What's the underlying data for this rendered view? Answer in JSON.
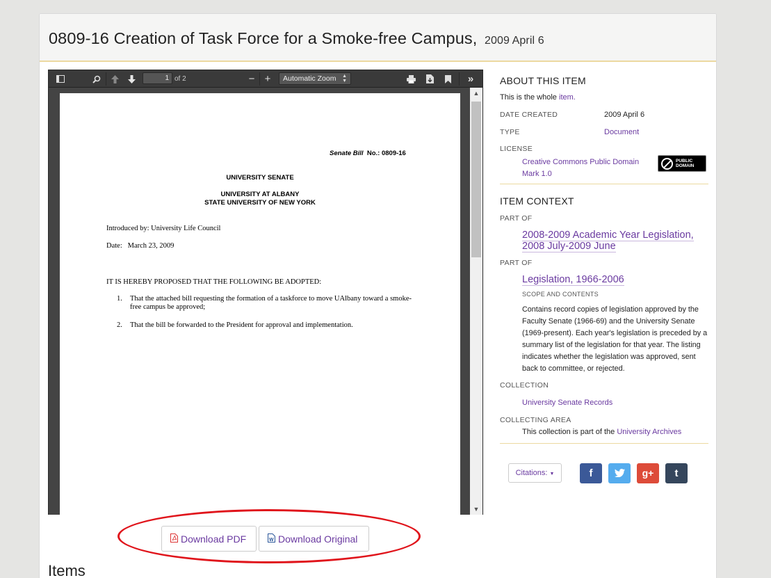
{
  "header": {
    "title": "0809-16 Creation of Task Force for a Smoke-free Campus,",
    "date": "2009 April 6"
  },
  "viewer": {
    "page_number": "1",
    "page_count_label": "of 2",
    "zoom": "Automatic Zoom",
    "icons": [
      "sidebar-toggle-icon",
      "search-icon",
      "previous-page-icon",
      "next-page-icon",
      "zoom-out-icon",
      "zoom-in-icon",
      "print-icon",
      "download-icon",
      "bookmark-icon",
      "tools-icon"
    ]
  },
  "document": {
    "bill_label": "Senate Bill",
    "bill_no": "No.: 0809-16",
    "senate": "UNIVERSITY SENATE",
    "univ": "UNIVERSITY AT ALBANY",
    "suny": "STATE UNIVERSITY OF NEW YORK",
    "introduced": "Introduced by: University Life Council",
    "date_label": "Date:",
    "date_value": "March 23, 2009",
    "proposal": "IT IS HEREBY PROPOSED THAT THE FOLLOWING BE ADOPTED:",
    "items": [
      {
        "num": "1.",
        "text": "That the attached bill requesting the formation of a taskforce to move UAlbany toward a smoke-free campus be approved;"
      },
      {
        "num": "2.",
        "text": "That the bill be forwarded to the President for approval and implementation."
      }
    ]
  },
  "downloads": {
    "pdf": "Download PDF",
    "original": "Download Original"
  },
  "items_heading": "Items",
  "about": {
    "title": "ABOUT THIS ITEM",
    "whole_prefix": "This is the whole",
    "whole_link": "item.",
    "date_created_label": "DATE CREATED",
    "date_created": "2009 April 6",
    "type_label": "TYPE",
    "type": "Document",
    "license_label": "LICENSE",
    "license_line1": "Creative Commons Public Domain",
    "license_line2": "Mark 1.0",
    "badge_line1": "PUBLIC",
    "badge_line2": "DOMAIN"
  },
  "context": {
    "title": "ITEM CONTEXT",
    "part_of_label": "PART OF",
    "part1_line1": "2008-2009 Academic Year Legislation,",
    "part1_line2": "2008 July-2009 June",
    "part_of_label2": "PART OF",
    "part2": "Legislation, 1966-2006",
    "scope_label": "SCOPE AND CONTENTS",
    "scope_text": "Contains record copies of legislation approved by the Faculty Senate (1966-69) and the University Senate (1969-present). Each year's legislation is preceded by a summary list of the legislation for that year. The listing indicates whether the legislation was approved, sent back to committee, or rejected.",
    "collection_label": "COLLECTION",
    "collection": "University Senate Records",
    "area_label": "COLLECTING AREA",
    "area_prefix": "This collection is part of the",
    "area_link": "University Archives"
  },
  "share": {
    "citations": "Citations:",
    "facebook": "f",
    "twitter": "t",
    "google": "g+",
    "tumblr": "t",
    "colors": {
      "facebook": "#3b5998",
      "twitter": "#55acee",
      "google": "#dd4b39",
      "tumblr": "#35465c"
    }
  }
}
